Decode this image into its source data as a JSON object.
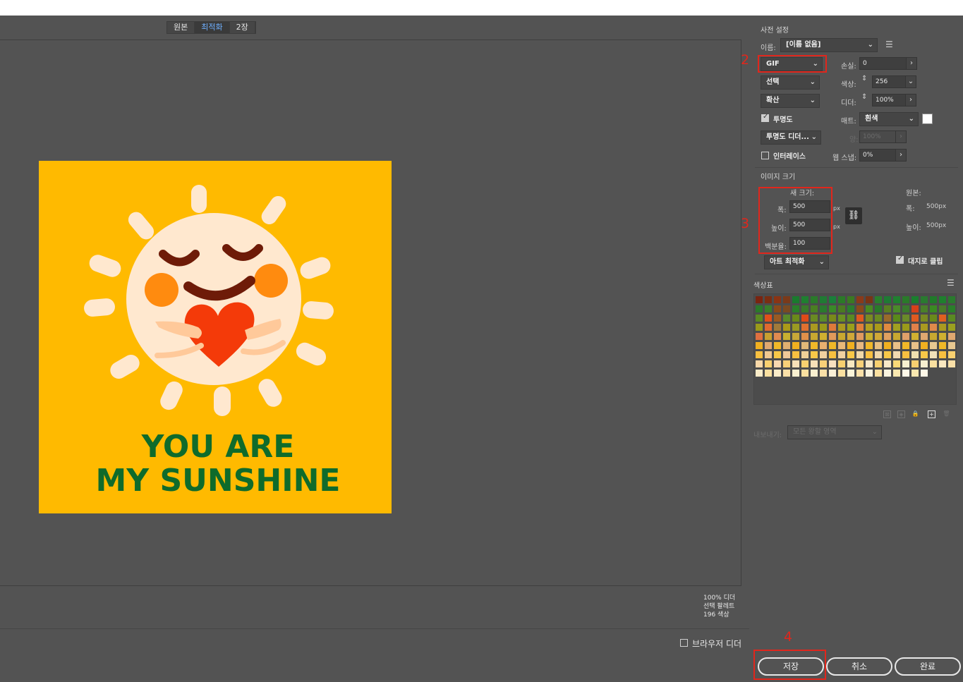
{
  "tabs": [
    {
      "label": "원본",
      "active": false
    },
    {
      "label": "최적화",
      "active": true
    },
    {
      "label": "2장",
      "active": false
    }
  ],
  "artwork": {
    "line1": "YOU ARE",
    "line2": "MY SUNSHINE",
    "bg_color": "#FFBA00"
  },
  "info": {
    "line1": "100% 디더",
    "line2": "선택 팔레트",
    "line3": "196 색상"
  },
  "browser_dither": {
    "label": "브라우저 디더",
    "checked": false
  },
  "panel": {
    "preset_title": "사전 설정",
    "name_label": "이름:",
    "name_value": "[이름 없음]",
    "format": "GIF",
    "lossy_label": "손실:",
    "lossy_value": "0",
    "reduction": "선택",
    "colors_label": "색상:",
    "colors_value": "256",
    "dither_algo": "확산",
    "dither_label": "디더:",
    "dither_value": "100%",
    "transparency_label": "투명도",
    "transparency_checked": true,
    "matte_label": "매트:",
    "matte_value": "흰색",
    "matte_color": "#ffffff",
    "trans_dither": "투명도 디더...",
    "amount_label": "양:",
    "amount_value": "100%",
    "interlace_label": "인터레이스",
    "interlace_checked": false,
    "websnap_label": "웹 스냅:",
    "websnap_value": "0%",
    "image_size_title": "이미지 크기",
    "new_size_label": "새 크기:",
    "width_label": "폭:",
    "width_value": "500",
    "height_label": "높이:",
    "height_value": "500",
    "percent_label": "백분율:",
    "percent_value": "100",
    "unit": "px",
    "original_label": "원본:",
    "orig_width_label": "폭:",
    "orig_width_value": "500px",
    "orig_height_label": "높이:",
    "orig_height_value": "500px",
    "quality": "아트 최적화",
    "clip_label": "대지로 클립",
    "clip_checked": true,
    "color_table_title": "색상표",
    "export_label": "내보내기:",
    "export_value": "모든 왕할 영역"
  },
  "palette_colors": [
    "#7a2410",
    "#7a2e12",
    "#8a3414",
    "#7a3a1a",
    "#1a7a2e",
    "#1f7f30",
    "#2a7a2a",
    "#207a34",
    "#1a7f3a",
    "#2b7a28",
    "#3a7a22",
    "#8a3a1a",
    "#7a3414",
    "#2a7f2e",
    "#1f7a34",
    "#207f30",
    "#2a7a2a",
    "#1a7f2e",
    "#2a7a30",
    "#207a2a",
    "#1f7f2e",
    "#2a7a2e",
    "#2a7a2a",
    "#3a7f2a",
    "#8a4a1a",
    "#7a4a22",
    "#2a7f2a",
    "#3a7a2a",
    "#4a7f22",
    "#2a7a2e",
    "#3a8a28",
    "#4a7a22",
    "#2a7f2e",
    "#8a4a1a",
    "#4a8a22",
    "#2a7a2a",
    "#5a7f22",
    "#4a8a2a",
    "#3a7a2e",
    "#d8401a",
    "#4a7f2a",
    "#3a8a22",
    "#4a7a2a",
    "#2a7f2a",
    "#5a8a22",
    "#e0501a",
    "#9a5a22",
    "#5a8a2a",
    "#6a8a1a",
    "#e04a18",
    "#6a8a22",
    "#5a8a2a",
    "#7a8a1a",
    "#6a9022",
    "#5a8a22",
    "#e0581e",
    "#7a8a22",
    "#6a8a22",
    "#9a6a2a",
    "#5a8a1a",
    "#6a8a2a",
    "#e05a20",
    "#7a8a22",
    "#6a8a1a",
    "#e06020",
    "#5a8a22",
    "#9a9a1a",
    "#e06a30",
    "#a07a3a",
    "#aa9a18",
    "#9a9a22",
    "#e07030",
    "#aa9a20",
    "#9a9a1a",
    "#e07a3a",
    "#aa9a20",
    "#9aa01a",
    "#e0803a",
    "#b0a020",
    "#aa9a1a",
    "#e08a40",
    "#a0a020",
    "#9a9a1a",
    "#e0804a",
    "#aa9a20",
    "#e08a4a",
    "#aa9a20",
    "#9aa020",
    "#e07040",
    "#c8a030",
    "#e08a50",
    "#c8b030",
    "#c8a838",
    "#e0904a",
    "#c8a830",
    "#d0b030",
    "#e09a5a",
    "#c8a830",
    "#d0a838",
    "#e09a60",
    "#c8b030",
    "#d0a838",
    "#e0a060",
    "#c8a830",
    "#e0a06a",
    "#d0b030",
    "#e0a870",
    "#c8a830",
    "#d0b030",
    "#e0a870",
    "#f0b020",
    "#e0a870",
    "#f0b828",
    "#e0b070",
    "#f0b020",
    "#e0b878",
    "#f0b828",
    "#e8b070",
    "#f0b828",
    "#e8b878",
    "#f0b020",
    "#e8b880",
    "#f0b828",
    "#e8c080",
    "#f0b020",
    "#e8c088",
    "#f0b828",
    "#e8c088",
    "#f0b020",
    "#e8c890",
    "#f0b828",
    "#e8c890",
    "#f8c040",
    "#f0c890",
    "#f8c848",
    "#f0c898",
    "#f8c040",
    "#f0d098",
    "#f8c848",
    "#f0d0a0",
    "#f8c040",
    "#f0d0a0",
    "#f8c848",
    "#f0d8a8",
    "#f8c040",
    "#f0d8a8",
    "#f8c848",
    "#f0d8b0",
    "#f8c040",
    "#f0e0b0",
    "#f8c848",
    "#f0e0b8",
    "#f8c040",
    "#f8d070",
    "#f8d8a8",
    "#f8d070",
    "#f8d8b0",
    "#f8d078",
    "#f8e0b8",
    "#f8d070",
    "#f8e0b8",
    "#f8d078",
    "#f8e0c0",
    "#f8d070",
    "#f8e8c0",
    "#f8d078",
    "#f8e8c8",
    "#f8d070",
    "#f8e8c8",
    "#f8d878",
    "#f8f0d0",
    "#f8d070",
    "#f8f0d0",
    "#fae0a0",
    "#fae8c0",
    "#fae0a8",
    "#faecc8",
    "#fae0a0",
    "#faecc8",
    "#fae0a8",
    "#faf0d0",
    "#fae0a0",
    "#faf0d0",
    "#fae0a8",
    "#faf0d8",
    "#fae0a0",
    "#faf4d8",
    "#fae0a8",
    "#faf4e0",
    "#fae0a0",
    "#faf4e0",
    "#fae8b0",
    "#fef8e8",
    "#fae8b0",
    "#fef8e8"
  ],
  "annotations": [
    "2",
    "3",
    "4"
  ],
  "buttons": {
    "save": "저장",
    "cancel": "취소",
    "done": "완료"
  }
}
